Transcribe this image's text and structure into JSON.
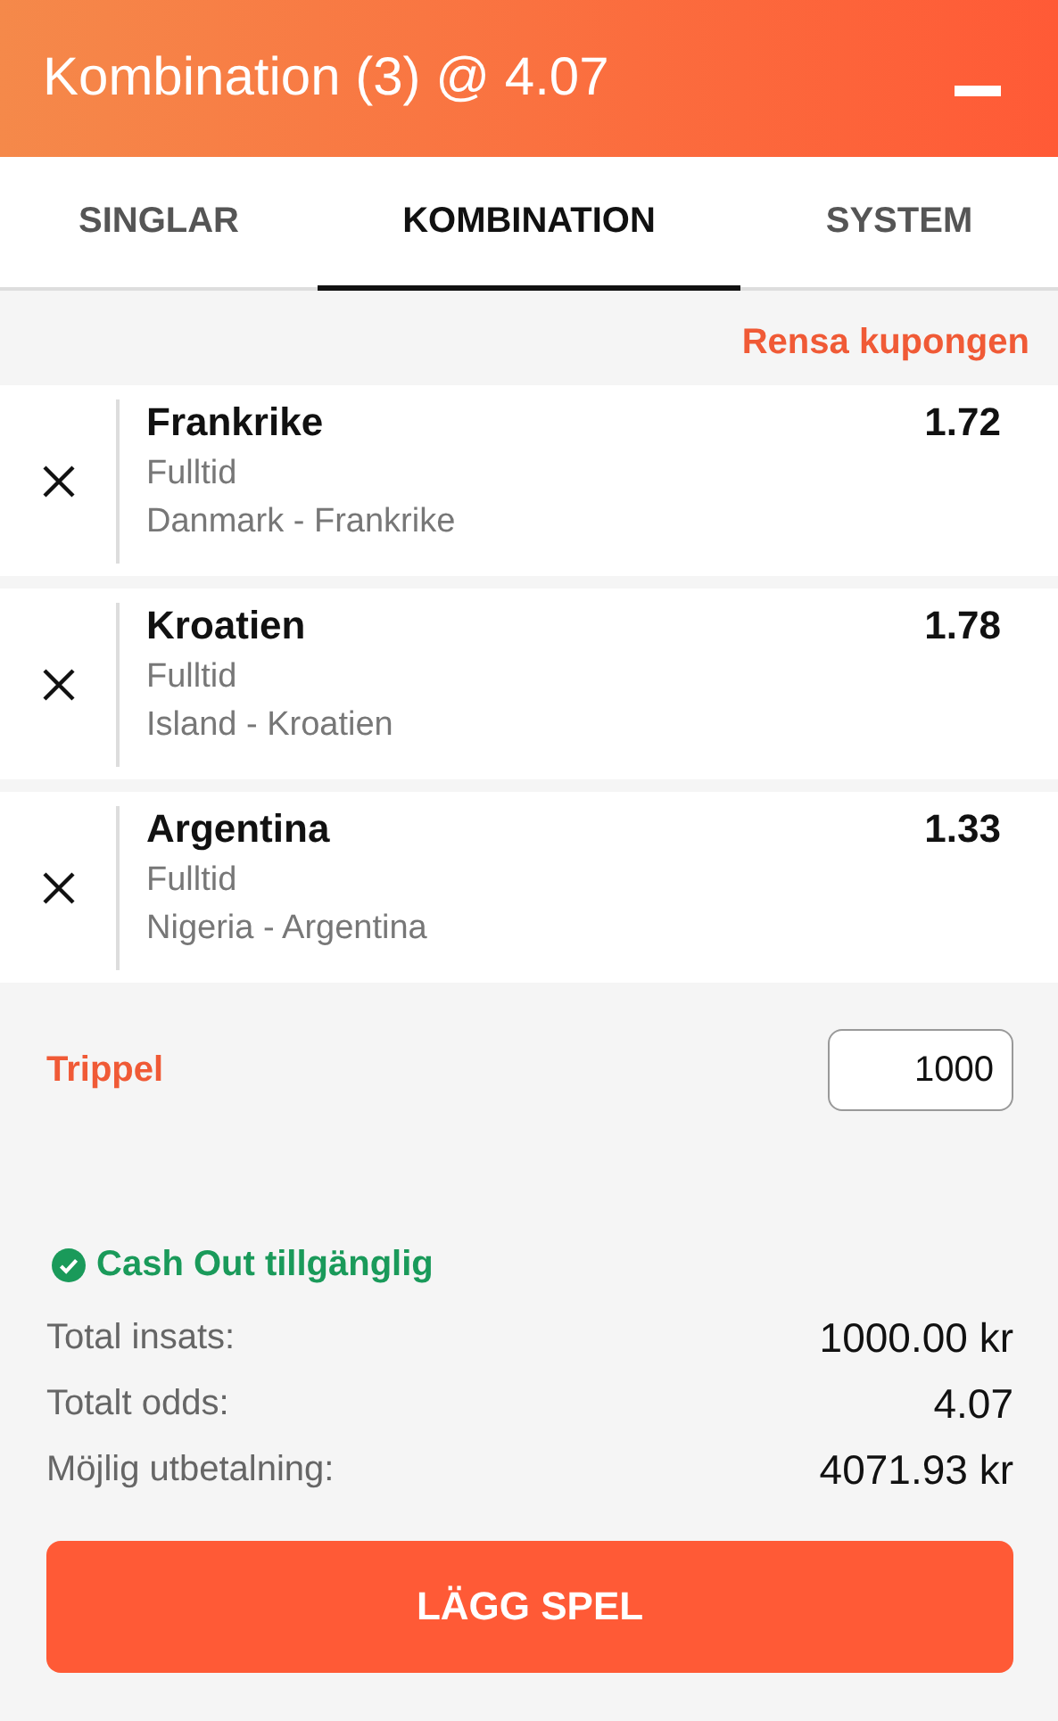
{
  "header": {
    "title": "Kombination (3) @ 4.07"
  },
  "tabs": [
    {
      "label": "SINGLAR",
      "selected": false
    },
    {
      "label": "KOMBINATION",
      "selected": true
    },
    {
      "label": "SYSTEM",
      "selected": false
    }
  ],
  "clear_link": "Rensa kupongen",
  "bets": [
    {
      "selection": "Frankrike",
      "market": "Fulltid",
      "match": "Danmark - Frankrike",
      "odds": "1.72"
    },
    {
      "selection": "Kroatien",
      "market": "Fulltid",
      "match": "Island - Kroatien",
      "odds": "1.78"
    },
    {
      "selection": "Argentina",
      "market": "Fulltid",
      "match": "Nigeria - Argentina",
      "odds": "1.33"
    }
  ],
  "stake": {
    "label": "Trippel",
    "value": "1000"
  },
  "cash_out": {
    "label": "Cash Out tillgänglig",
    "available": true
  },
  "summary": [
    {
      "label": "Total insats:",
      "value": "1000.00 kr"
    },
    {
      "label": "Totalt odds:",
      "value": "4.07"
    },
    {
      "label": "Möjlig utbetalning:",
      "value": "4071.93 kr"
    }
  ],
  "place_button": "LÄGG SPEL"
}
